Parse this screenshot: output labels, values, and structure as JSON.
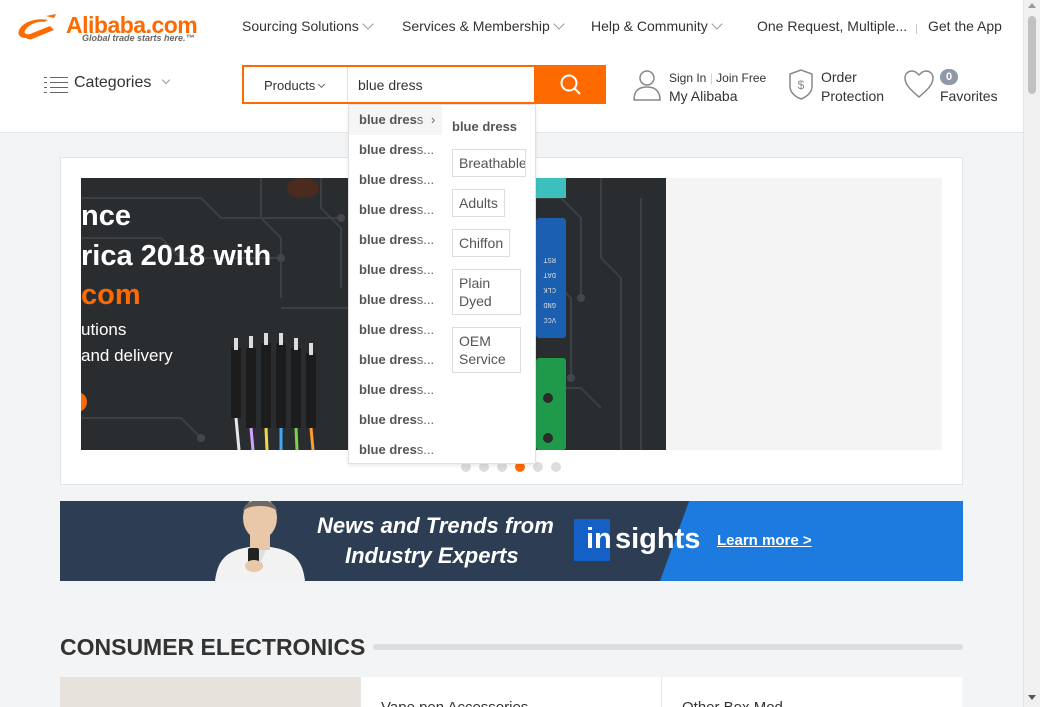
{
  "logo": {
    "brand": "Alibaba.com",
    "tagline": "Global trade starts here.™"
  },
  "top_nav": [
    {
      "label": "Sourcing Solutions"
    },
    {
      "label": "Services & Membership"
    },
    {
      "label": "Help & Community"
    },
    {
      "label": "One Request, Multiple..."
    },
    {
      "label": "Get the App"
    }
  ],
  "categories_label": "Categories",
  "search": {
    "type_label": "Products",
    "query": "blue dress",
    "button_icon": "search-icon"
  },
  "user": {
    "sign_in": "Sign In",
    "join": "Join Free",
    "my_alibaba": "My Alibaba"
  },
  "order": {
    "line1": "Order",
    "line2": "Protection"
  },
  "favorites": {
    "count": "0",
    "label": "Favorites"
  },
  "suggestions": {
    "items": [
      {
        "bold": "blue dres",
        "rest": "s"
      },
      {
        "bold": "blue dres",
        "rest": "s..."
      },
      {
        "bold": "blue dres",
        "rest": "s..."
      },
      {
        "bold": "blue dres",
        "rest": "s..."
      },
      {
        "bold": "blue dres",
        "rest": "s..."
      },
      {
        "bold": "blue dres",
        "rest": "s..."
      },
      {
        "bold": "blue dres",
        "rest": "s..."
      },
      {
        "bold": "blue dres",
        "rest": "s..."
      },
      {
        "bold": "blue dres",
        "rest": "s..."
      },
      {
        "bold": "blue dres",
        "rest": "s..."
      },
      {
        "bold": "blue dres",
        "rest": "s..."
      },
      {
        "bold": "blue dres",
        "rest": "s..."
      }
    ],
    "refine_title": "blue dress",
    "tags": [
      "Breathable",
      "Adults",
      "Chiffon",
      "Plain Dyed",
      "OEM Service"
    ]
  },
  "carousel": {
    "lines": [
      "nce",
      "rica 2018 with",
      "com",
      "utions",
      "and delivery"
    ],
    "dot_count": 6,
    "active_dot": 4
  },
  "insights": {
    "headline1": "News and Trends from",
    "headline2": "Industry Experts",
    "brand_in": "in",
    "brand_sights": "sights",
    "cta": "Learn more >"
  },
  "section": {
    "title": "CONSUMER ELECTRONICS",
    "cards": [
      "Vape pen Accessories",
      "Other Box Mod"
    ]
  },
  "colors": {
    "accent": "#ff6a00",
    "insights_bg": "#2d3e54",
    "insights_blue": "#1d7be0"
  }
}
